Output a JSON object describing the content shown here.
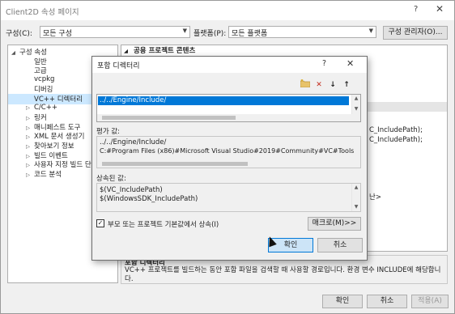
{
  "window": {
    "title": "Client2D 속성 페이지",
    "help": "?",
    "close": "✕"
  },
  "toolbar": {
    "config_label": "구성(C):",
    "config_value": "모든 구성",
    "platform_label": "플랫폼(P):",
    "platform_value": "모든 플랫폼",
    "config_manager": "구성 관리자(O)..."
  },
  "tree": {
    "items": [
      {
        "label": "구성 속성",
        "exp": "◢",
        "level": 0
      },
      {
        "label": "일반",
        "level": 1
      },
      {
        "label": "고급",
        "level": 1
      },
      {
        "label": "vcpkg",
        "level": 1
      },
      {
        "label": "디버깅",
        "level": 1
      },
      {
        "label": "VC++ 디렉터리",
        "level": 1,
        "selected": true
      },
      {
        "label": "C/C++",
        "exp": "▷",
        "level": 1
      },
      {
        "label": "링커",
        "exp": "▷",
        "level": 1
      },
      {
        "label": "매니페스트 도구",
        "exp": "▷",
        "level": 1
      },
      {
        "label": "XML 문서 생성기",
        "exp": "▷",
        "level": 1
      },
      {
        "label": "찾아보기 정보",
        "exp": "▷",
        "level": 1
      },
      {
        "label": "빌드 이벤트",
        "exp": "▷",
        "level": 1
      },
      {
        "label": "사용자 지정 빌드 단",
        "exp": "▷",
        "level": 1
      },
      {
        "label": "코드 분석",
        "exp": "▷",
        "level": 1
      }
    ]
  },
  "grid": {
    "header": "공용 프로젝트 콘텐츠",
    "header_exp": "◢",
    "fragments": [
      "C_IncludePath);",
      "C_IncludePath);",
      "난>"
    ]
  },
  "description": {
    "title": "포함 디렉터리",
    "body": "VC++ 프로젝트를 빌드하는 동안 포함 파일을 검색할 때 사용할 경로입니다. 환경 변수 INCLUDE에 해당합니다."
  },
  "footer": {
    "ok": "확인",
    "cancel": "취소",
    "apply": "적용(A)"
  },
  "dialog": {
    "title": "포함 디렉터리",
    "help": "?",
    "close": "✕",
    "list_items": [
      "../../Engine/Include/"
    ],
    "evaluated_label": "평가 값:",
    "evaluated_lines": [
      "../../Engine/Include/",
      "C:#Program Files (x86)#Microsoft Visual Studio#2019#Community#VC#Tools"
    ],
    "inherited_label": "상속된 값:",
    "inherited_lines": [
      "$(VC_IncludePath)",
      "$(WindowsSDK_IncludePath)"
    ],
    "inherit_checkbox": "부모 또는 프로젝트 기본값에서 상속(I)",
    "inherit_checked": true,
    "macros_button": "매크로(M)>>",
    "ok": "확인",
    "cancel": "취소",
    "toolbar_icons": [
      "new-folder-icon",
      "delete-icon",
      "move-down-icon",
      "move-up-icon"
    ]
  },
  "colors": {
    "accent": "#0078d7",
    "selection": "#cce8ff"
  }
}
